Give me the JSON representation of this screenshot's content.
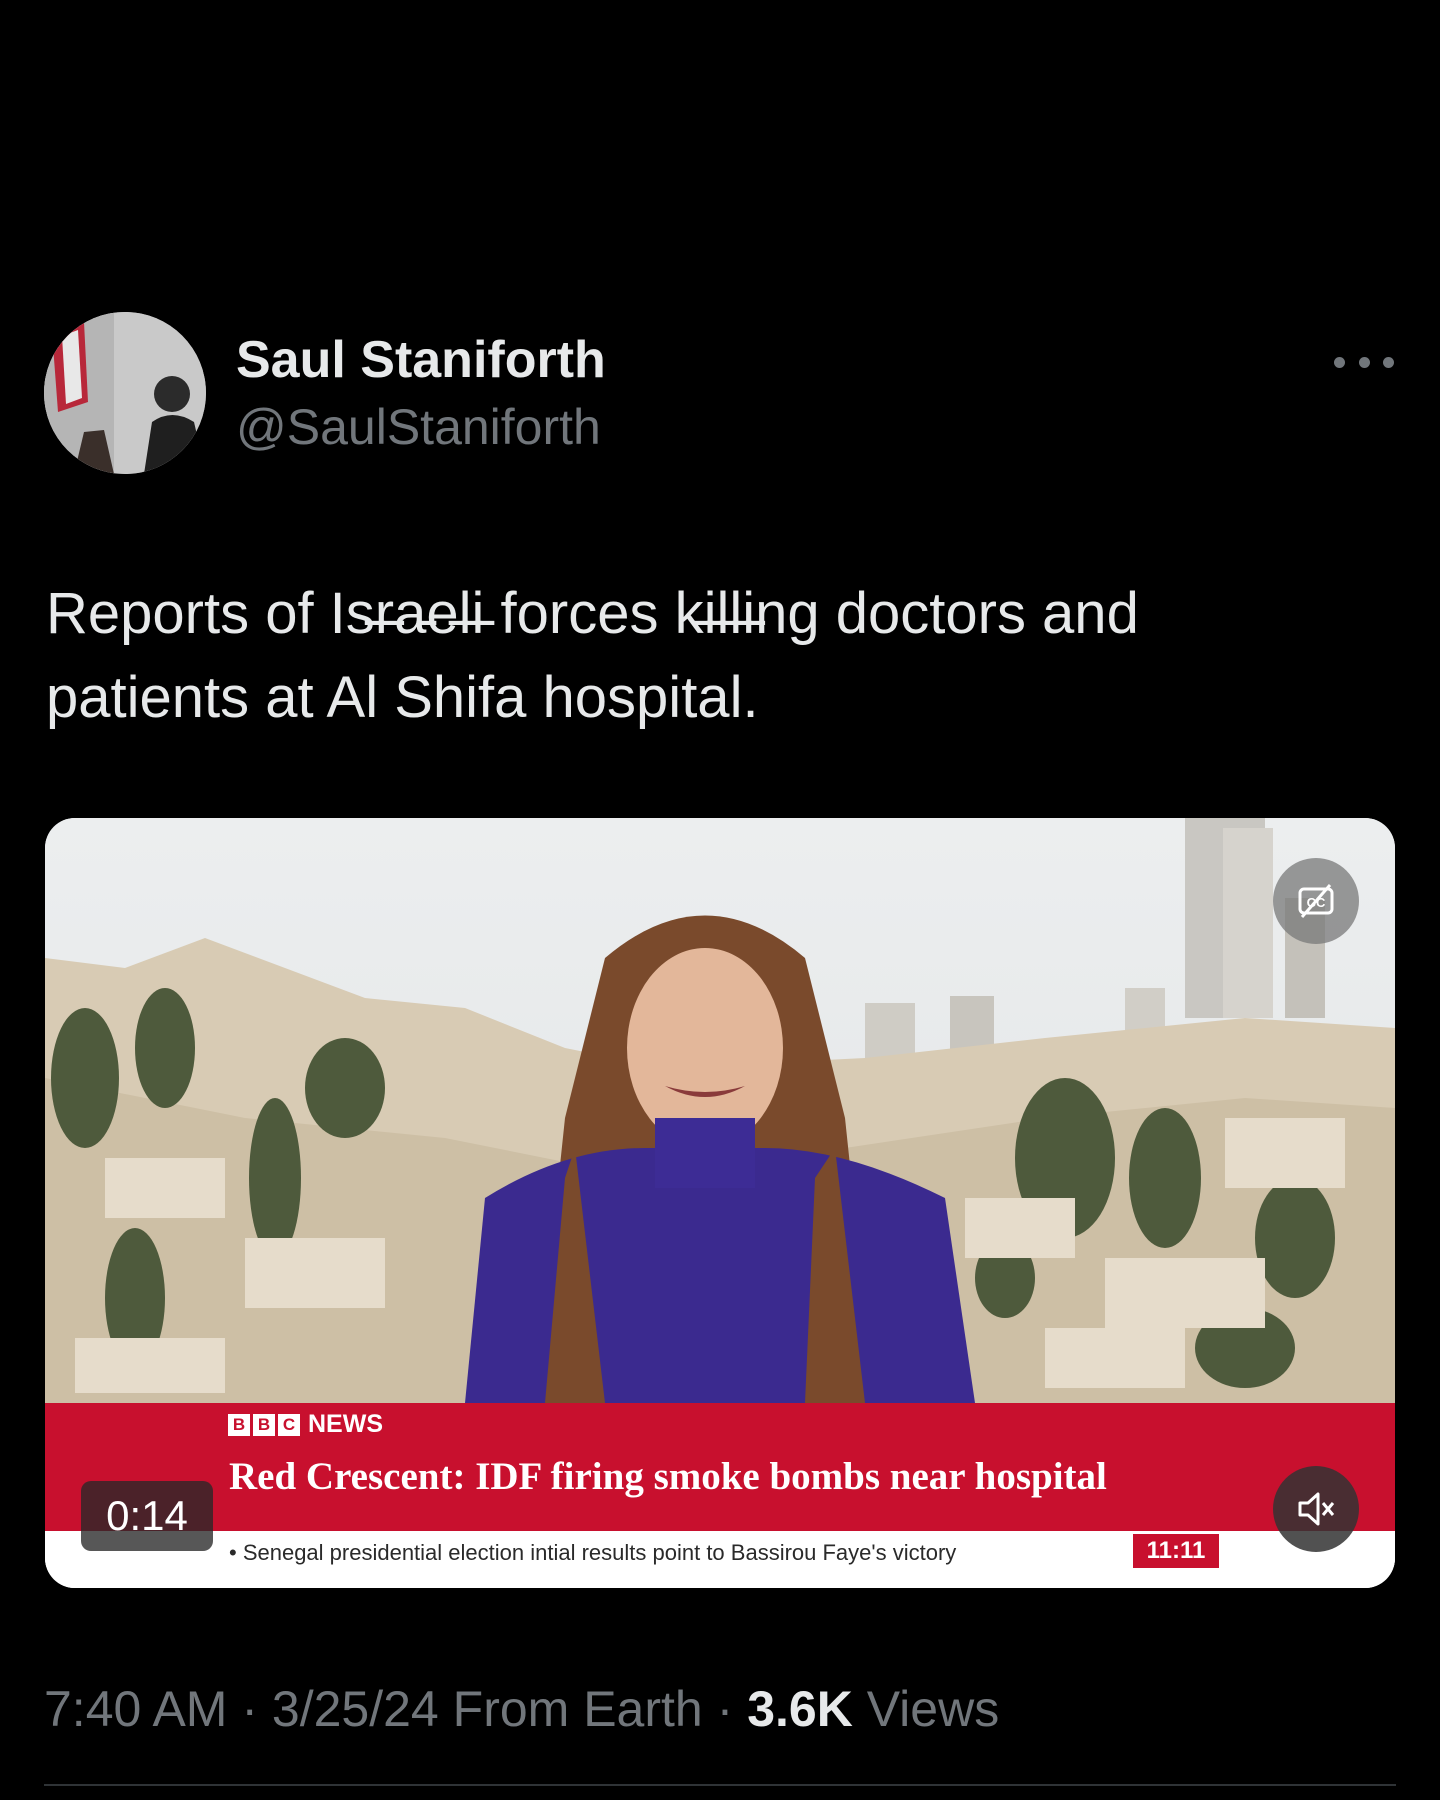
{
  "author": {
    "display_name": "Saul Staniforth",
    "handle": "@SaulStaniforth",
    "avatar_icon": "avatar-photo"
  },
  "more_icon": "ellipsis-icon",
  "tweet": {
    "text_line1": "Reports of Is̵r̵a̵e̵l̵i̵ forces k̵i̵l̵l̵i̵ng doctors and",
    "text_line2": "patients at Al Shifa hospital."
  },
  "video": {
    "duration": "0:14",
    "broadcaster_logo": [
      "B",
      "B",
      "C"
    ],
    "broadcaster_label": "NEWS",
    "headline": "Red Crescent: IDF firing smoke bombs near hospital",
    "ticker": "• Senegal presidential election intial results point to Bassirou Faye's victory",
    "clock": "11:11",
    "cc_icon": "captions-off-icon",
    "mute_icon": "muted-speaker-icon",
    "caption_color": "#c8102e"
  },
  "meta": {
    "time": "7:40 AM",
    "separator": "·",
    "date": "3/25/24",
    "source": "From Earth",
    "views_count": "3.6K",
    "views_label": "Views"
  }
}
